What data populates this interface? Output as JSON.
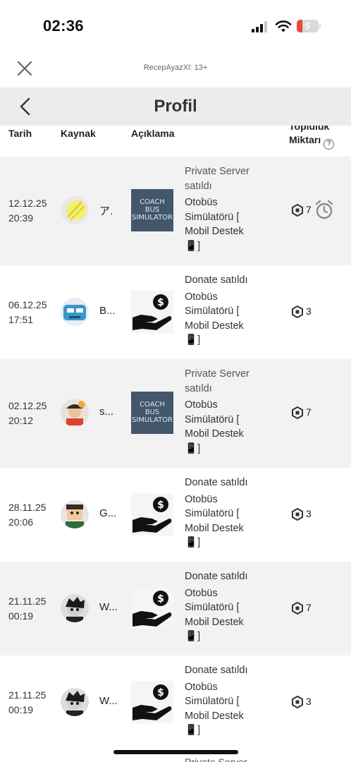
{
  "status_bar": {
    "time": "02:36",
    "battery_level": "5"
  },
  "topbar": {
    "account_label": "RecepAyazXl: 13+"
  },
  "header": {
    "title": "Profil"
  },
  "columns": {
    "date": "Tarih",
    "source": "Kaynak",
    "description": "Açıklama",
    "amount_line1": "Topluluk",
    "amount_line2": "Miktarı"
  },
  "rows": [
    {
      "date": "12.12.25",
      "time": "20:39",
      "source": "ア.",
      "sold": "Private Server satıldı",
      "thumb": "bus",
      "game": "Otobüs Simülatörü [ Mobil Destek",
      "tail": "]",
      "amount": "7",
      "pending": true
    },
    {
      "date": "06.12.25",
      "time": "17:51",
      "source": "B...",
      "sold": "Donate satıldı",
      "thumb": "donate",
      "game": "Otobüs Simülatörü [ Mobil Destek",
      "tail": "]",
      "amount": "3",
      "pending": false
    },
    {
      "date": "02.12.25",
      "time": "20:12",
      "source": "s...",
      "sold": "Private Server satıldı",
      "thumb": "bus",
      "game": "Otobüs Simülatörü [ Mobil Destek",
      "tail": "]",
      "amount": "7",
      "pending": false
    },
    {
      "date": "28.11.25",
      "time": "20:06",
      "source": "G...",
      "sold": "Donate satıldı",
      "thumb": "donate",
      "game": "Otobüs Simülatörü [ Mobil Destek",
      "tail": "]",
      "amount": "3",
      "pending": false
    },
    {
      "date": "21.11.25",
      "time": "00:19",
      "source": "W...",
      "sold": "Donate satıldı",
      "thumb": "donate",
      "game": "Otobüs Simülatörü [ Mobil Destek",
      "tail": "]",
      "amount": "7",
      "pending": false
    },
    {
      "date": "21.11.25",
      "time": "00:19",
      "source": "W...",
      "sold": "Donate satıldı",
      "thumb": "donate",
      "game": "Otobüs Simülatörü [ Mobil Destek",
      "tail": "]",
      "amount": "3",
      "pending": false
    }
  ],
  "thumb_text": {
    "bus_line1": "COACH",
    "bus_line2": "BUS",
    "bus_line3": "SIMULATOR"
  },
  "next_row_peek": "Private Server",
  "icons": {
    "close": "close-icon",
    "back": "chevron-left-icon",
    "help": "help-circle-icon",
    "robux": "robux-icon",
    "pending": "alarm-clock-icon",
    "phone": "mobile-phone-emoji"
  }
}
